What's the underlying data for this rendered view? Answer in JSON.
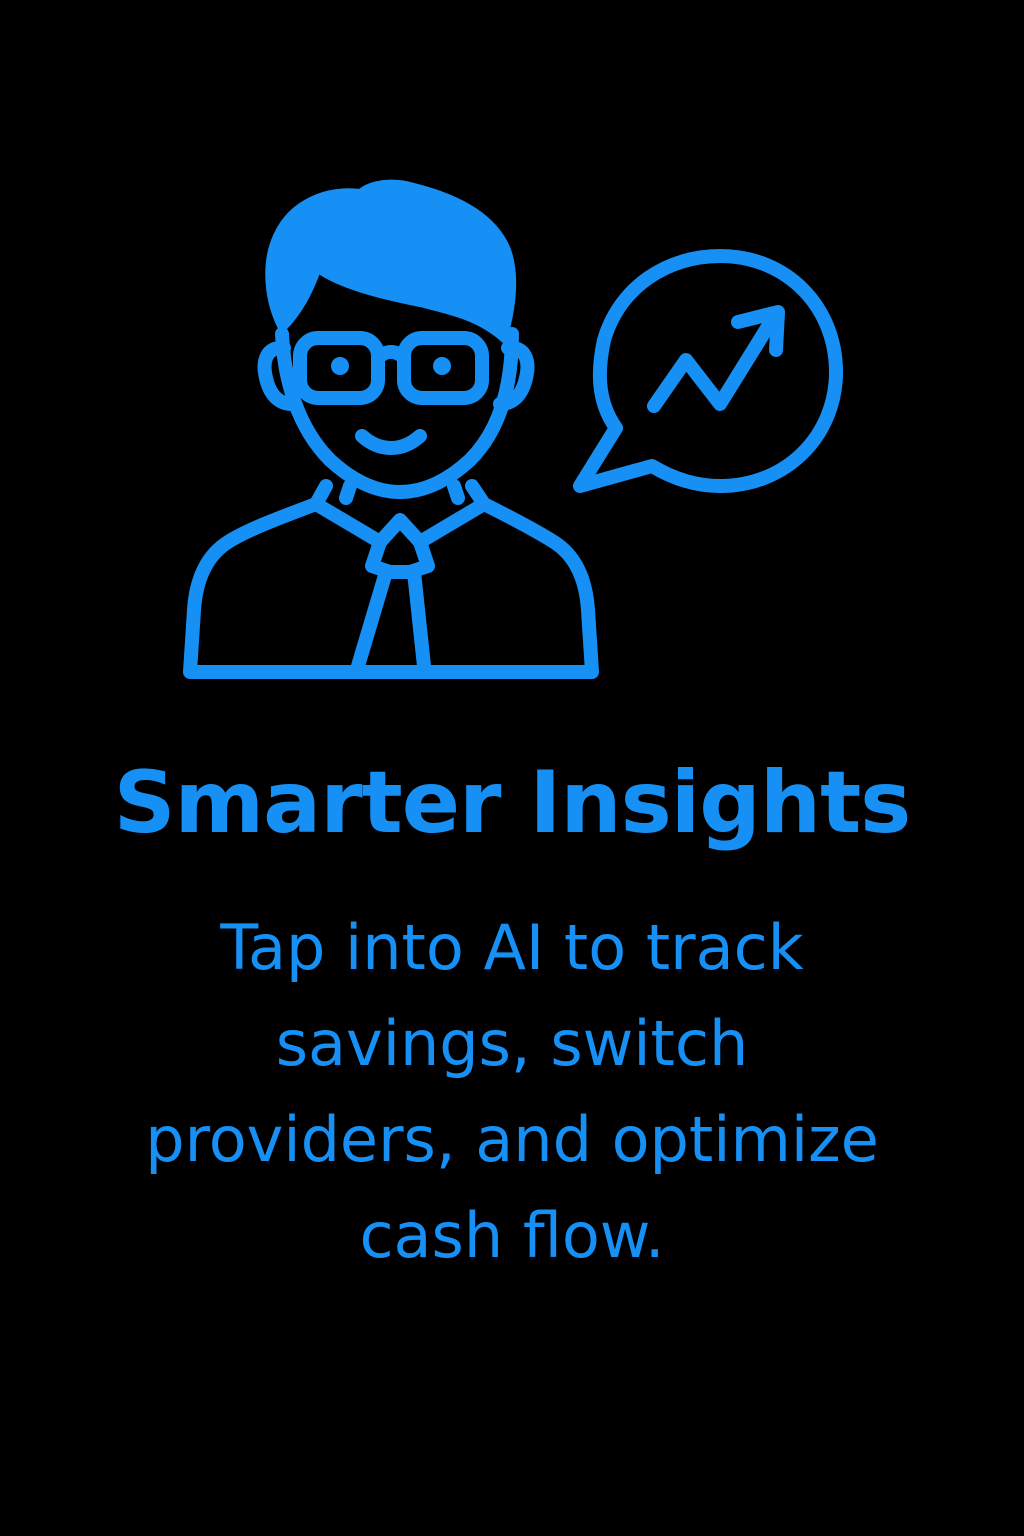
{
  "colors": {
    "background": "#000000",
    "accent": "#1690F4"
  },
  "illustration": {
    "person_icon": "businessman-with-glasses-icon",
    "bubble_icon": "speech-bubble-trend-up-icon"
  },
  "headline": "Smarter Insights",
  "body": {
    "lines": [
      "Tap into AI to track",
      "savings, switch",
      "providers, and optimize",
      "cash flow."
    ]
  }
}
